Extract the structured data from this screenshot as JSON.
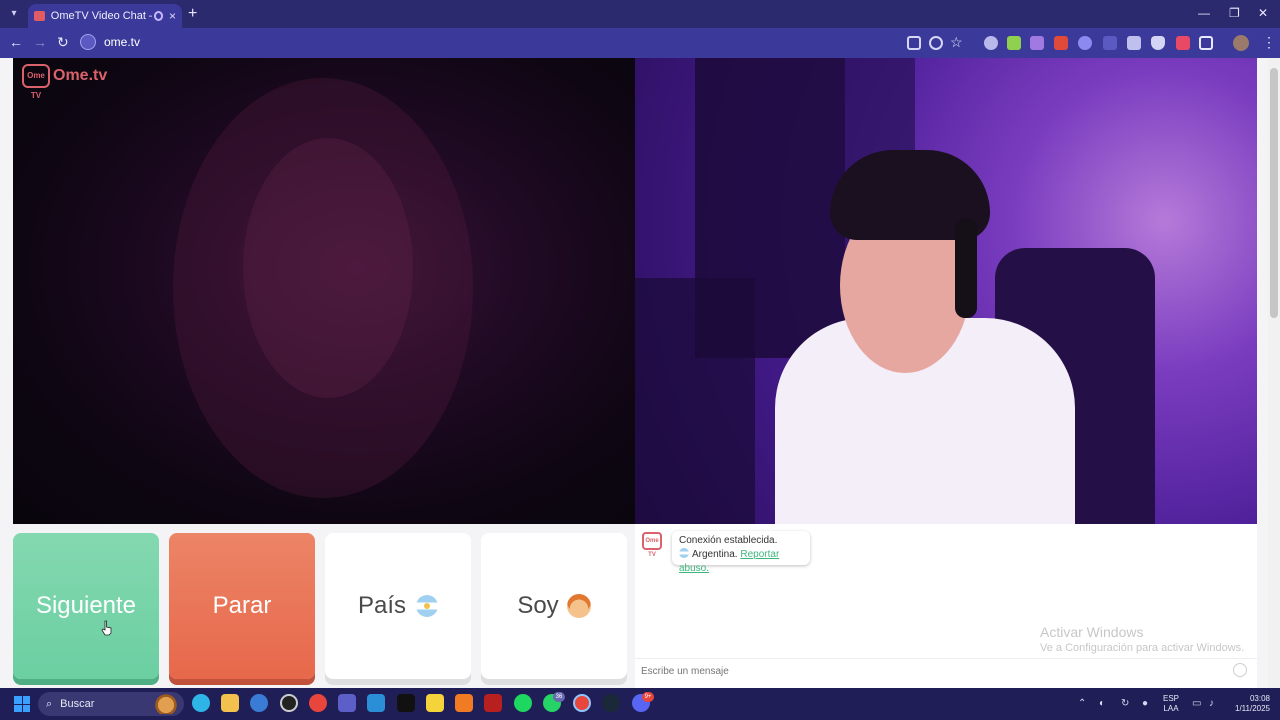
{
  "browser": {
    "tab_title": "OmeTV Video Chat — Ome",
    "url": "ome.tv",
    "new_tab": "+",
    "tab_close": "×"
  },
  "page": {
    "logo_tv": "Ome TV",
    "logo_text": "Ome.tv",
    "buttons": {
      "next": "Siguiente",
      "stop": "Parar",
      "country": "País",
      "gender": "Soy"
    },
    "chat": {
      "logo_tv": "Ome TV",
      "status": "Conexión establecida.",
      "country": "Argentina.",
      "report": "Reportar abuso.",
      "input_placeholder": "Escribe un mensaje"
    },
    "watermark": {
      "title": "Activar Windows",
      "subtitle": "Ve a Configuración para activar Windows."
    }
  },
  "taskbar": {
    "search_label": "Buscar",
    "lang_line1": "ESP",
    "lang_line2": "LAA",
    "time": "03:08",
    "date": "1/11/2025",
    "badge_whatsapp": "36",
    "badge_discord": "9+"
  },
  "colors": {
    "next": "#6bcfa2",
    "stop": "#e7684b",
    "brand": "#d9626b",
    "browser": "#3b3a9a"
  }
}
